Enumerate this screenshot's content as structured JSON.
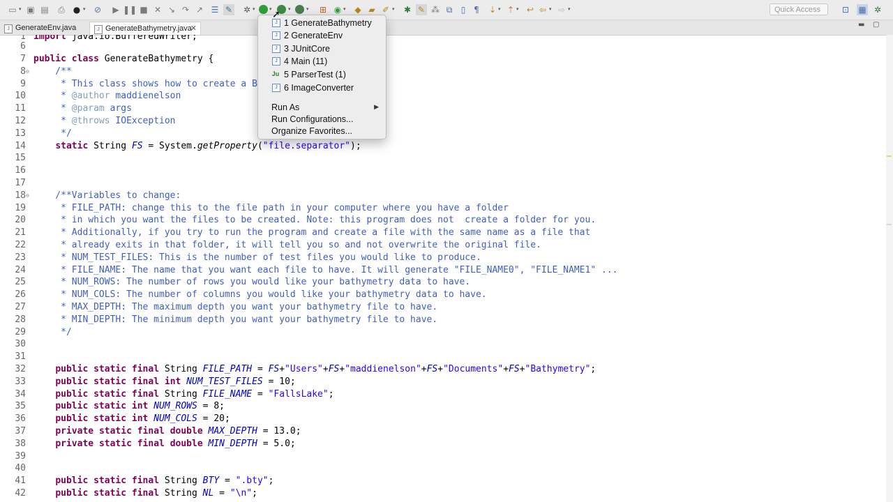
{
  "toolbar": {
    "quick_access_placeholder": "Quick Access",
    "icons": [
      "new-icon",
      "save-icon",
      "save-all-icon",
      "print-icon",
      "debug-icon",
      "skip-icon",
      "terminate-icon",
      "run-icon",
      "coverage-icon",
      "external-tools-icon",
      "open-type-icon",
      "search-icon",
      "perspective-icon"
    ]
  },
  "tabs": [
    {
      "label": "GenerateEnv.java",
      "active": false
    },
    {
      "label": "GenerateBathymetry.java",
      "active": true,
      "close": "✕"
    }
  ],
  "run_menu": {
    "history": [
      {
        "label": "1 GenerateBathymetry",
        "icon": "java-app-icon"
      },
      {
        "label": "2 GenerateEnv",
        "icon": "java-app-icon"
      },
      {
        "label": "3 JUnitCore",
        "icon": "java-app-icon"
      },
      {
        "label": "4 Main (11)",
        "icon": "java-app-icon"
      },
      {
        "label": "5 ParserTest (1)",
        "icon": "junit-icon"
      },
      {
        "label": "6 ImageConverter",
        "icon": "java-app-icon"
      }
    ],
    "run_as": "Run As",
    "run_configurations": "Run Configurations...",
    "organize_favorites": "Organize Favorites..."
  },
  "editor": {
    "lines": [
      {
        "n": "1",
        "text": "import java.io.BufferedWriter;"
      },
      {
        "n": "6",
        "text": ""
      },
      {
        "n": "7",
        "text": "public class GenerateBathymetry {"
      },
      {
        "n": "8",
        "text": "    /**",
        "fold": true
      },
      {
        "n": "9",
        "text": "     * This class shows how to create a Bat"
      },
      {
        "n": "10",
        "text": "     * @author maddienelson"
      },
      {
        "n": "11",
        "text": "     * @param args"
      },
      {
        "n": "12",
        "text": "     * @throws IOException"
      },
      {
        "n": "13",
        "text": "     */"
      },
      {
        "n": "14",
        "text": "    static String FS = System.getProperty(\"file.separator\");"
      },
      {
        "n": "15",
        "text": ""
      },
      {
        "n": "16",
        "text": ""
      },
      {
        "n": "17",
        "text": ""
      },
      {
        "n": "18",
        "text": "    /**Variables to change:",
        "fold": true
      },
      {
        "n": "19",
        "text": "     * FILE_PATH: change this to the file path in your computer where you have a folder"
      },
      {
        "n": "20",
        "text": "     * in which you want the files to be created. Note: this program does not  create a folder for you."
      },
      {
        "n": "21",
        "text": "     * Additionally, if you try to run the program and create a file with the same name as a file that"
      },
      {
        "n": "22",
        "text": "     * already exits in that folder, it will tell you so and not overwrite the original file."
      },
      {
        "n": "23",
        "text": "     * NUM_TEST_FILES: This is the number of test files you would like to produce."
      },
      {
        "n": "24",
        "text": "     * FILE_NAME: The name that you want each file to have. It will generate \"FILE_NAME0\", \"FILE_NAME1\" ..."
      },
      {
        "n": "25",
        "text": "     * NUM_ROWS: The number of rows you would like your bathymetry data to have."
      },
      {
        "n": "26",
        "text": "     * NUM_COLS: The number of columns you would like your bathymetry data to have."
      },
      {
        "n": "27",
        "text": "     * MAX_DEPTH: The maximum depth you want your bathymetry file to have."
      },
      {
        "n": "28",
        "text": "     * MIN_DEPTH: The minimum depth you want your bathymetry file to have."
      },
      {
        "n": "29",
        "text": "     */"
      },
      {
        "n": "30",
        "text": ""
      },
      {
        "n": "31",
        "text": ""
      },
      {
        "n": "32",
        "text": "    public static final String FILE_PATH = FS+\"Users\"+FS+\"maddienelson\"+FS+\"Documents\"+FS+\"Bathymetry\";"
      },
      {
        "n": "33",
        "text": "    public static final int NUM_TEST_FILES = 10;"
      },
      {
        "n": "34",
        "text": "    public static final String FILE_NAME = \"FallsLake\";"
      },
      {
        "n": "35",
        "text": "    public static int NUM_ROWS = 8;"
      },
      {
        "n": "36",
        "text": "    public static int NUM_COLS = 20;"
      },
      {
        "n": "37",
        "text": "    private static final double MAX_DEPTH = 13.0;"
      },
      {
        "n": "38",
        "text": "    private static final double MIN_DEPTH = 5.0;"
      },
      {
        "n": "39",
        "text": ""
      },
      {
        "n": "40",
        "text": ""
      },
      {
        "n": "41",
        "text": "    public static final String BTY = \".bty\";"
      },
      {
        "n": "42",
        "text": "    public static final String NL = \"\\n\";"
      }
    ]
  },
  "colors": {
    "keyword": "#7f0055",
    "string": "#2a00ff",
    "comment": "#3f5fbf",
    "javadoc_tag": "#7f9fbf",
    "static_field": "#0000c0"
  }
}
